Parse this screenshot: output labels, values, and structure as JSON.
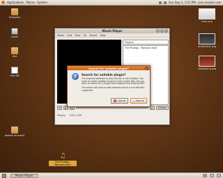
{
  "top_panel": {
    "menus": [
      "Applications",
      "Places",
      "System"
    ],
    "clock": "Sun Sep 3, 3:51 PM",
    "user": "Live session user"
  },
  "desktop": {
    "icons": [
      {
        "label": "Examples"
      },
      {
        "label": "Install"
      },
      {
        "label": "test"
      },
      {
        "label": "new file"
      },
      {
        "label": "tofbroe ahrsrhrtf"
      },
      {
        "label": "The Prodigy - Narayan.mp3"
      }
    ],
    "thumbnails": [
      {
        "label": "lasio.png"
      },
      {
        "label": "Screenshot.png"
      },
      {
        "label": "networking.png"
      }
    ]
  },
  "player": {
    "title": "Movie Player",
    "menu": [
      "Movie",
      "Edit",
      "View",
      "Go",
      "Sound",
      "Help"
    ],
    "sidebar_select": "Playlist",
    "playlist": [
      "The Prodigy - Narayan.mp3"
    ],
    "sidebar_button": "Sidebar",
    "status_left": "Playing",
    "status_time": "0:00 / 0:00"
  },
  "dialog": {
    "title": "Search for suitable plugin?",
    "heading": "Search for suitable plugin?",
    "paragraph1": "The required software to play this file is not installed. You need to install suitable plugins to play media files. Do you want to search for a plugin that supports the selected file?",
    "paragraph2": "The search will also include software which is not officially supported.",
    "cancel_label": "Cancel",
    "search_label": "Search"
  },
  "bottom_panel": {
    "task_label": "Movie Player"
  }
}
